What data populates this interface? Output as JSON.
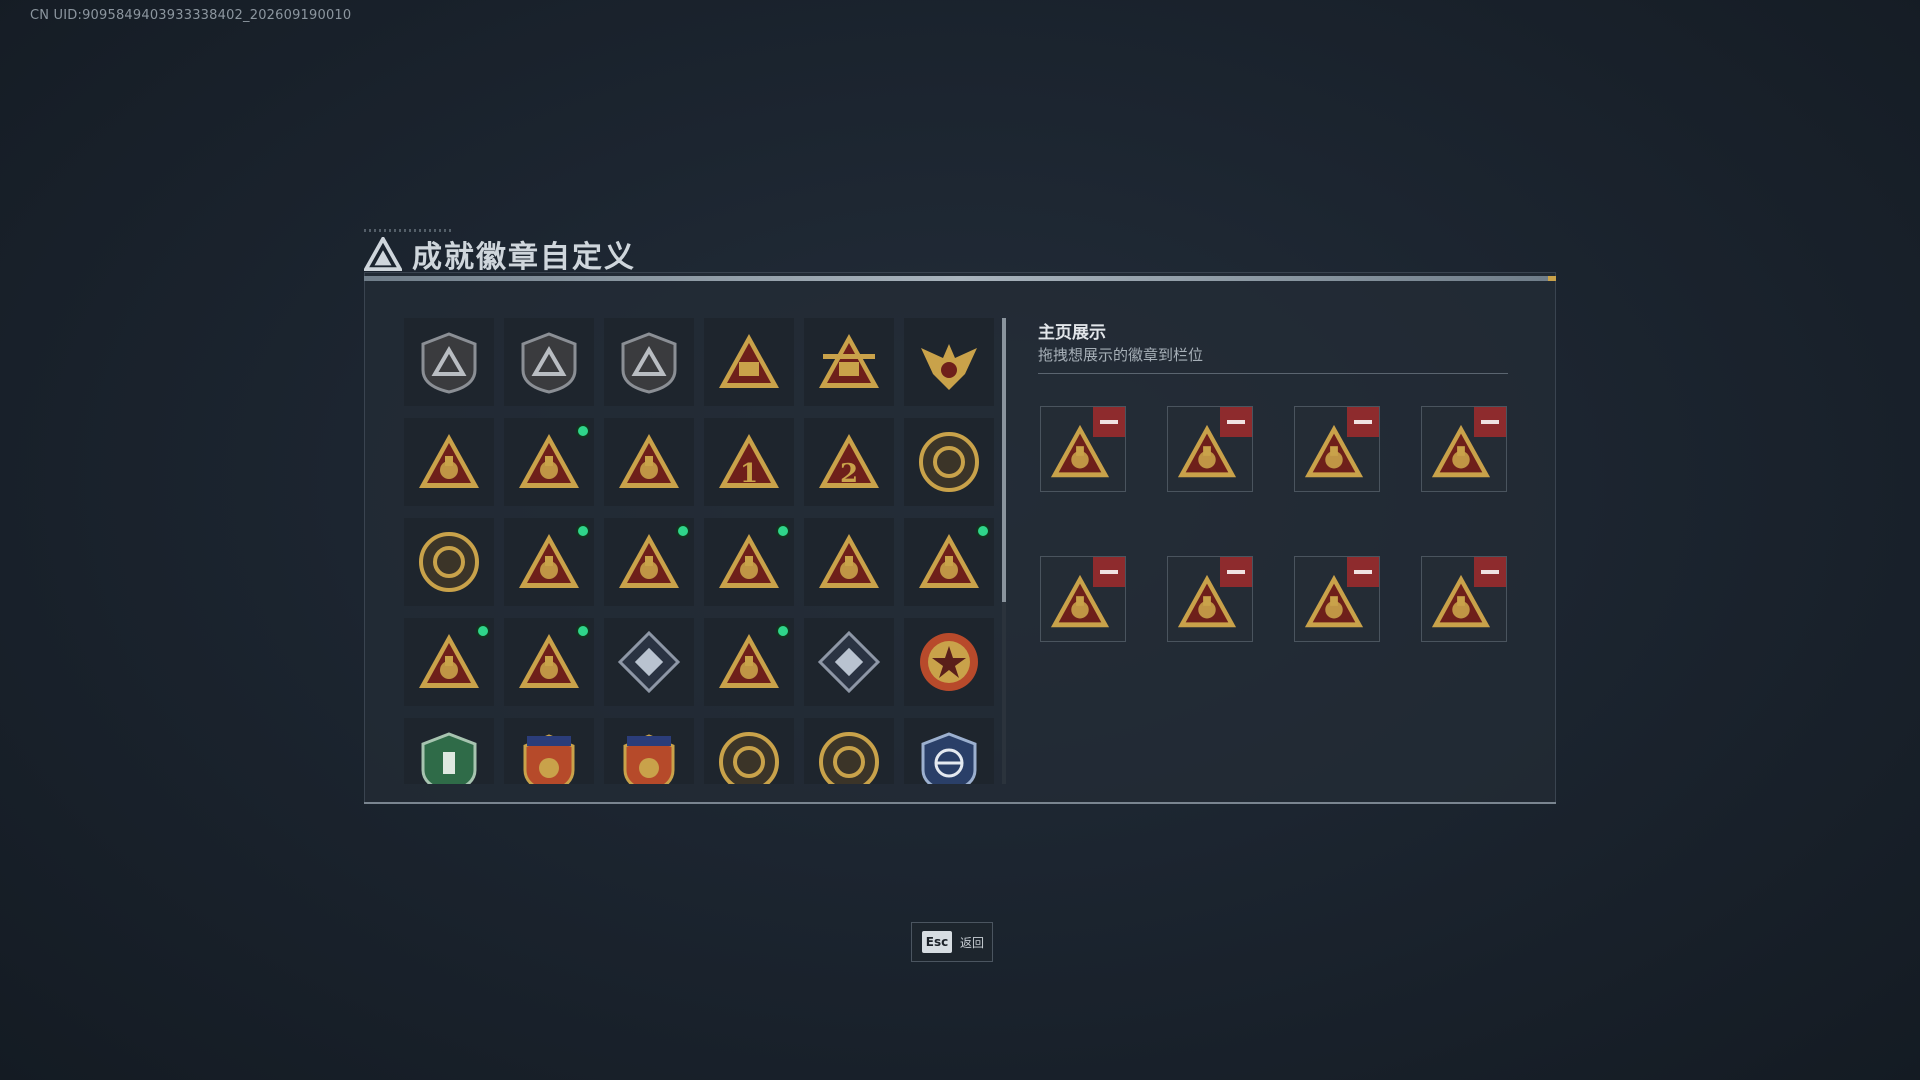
{
  "uid_text": "CN UID:9095849403933338402_202609190010",
  "title": "成就徽章自定义",
  "showcase": {
    "title": "主页展示",
    "subtitle": "拖拽想展示的徽章到栏位"
  },
  "badges": [
    {
      "icon": "shield-emblem-icon",
      "new": false
    },
    {
      "icon": "shield-helicopter-icon",
      "new": false
    },
    {
      "icon": "shield-diamond-icon",
      "new": false
    },
    {
      "icon": "triangle-sb-icon",
      "new": false
    },
    {
      "icon": "triangle-winged-sb-icon",
      "new": false
    },
    {
      "icon": "eagle-crest-icon",
      "new": false
    },
    {
      "icon": "triangle-hand-icon",
      "new": false
    },
    {
      "icon": "triangle-bowl-icon",
      "new": true
    },
    {
      "icon": "triangle-soldier-icon",
      "new": false
    },
    {
      "icon": "triangle-number-one-icon",
      "new": false
    },
    {
      "icon": "triangle-number-two-icon",
      "new": false
    },
    {
      "icon": "round-wreath-icon",
      "new": false
    },
    {
      "icon": "round-helmet-icon",
      "new": false
    },
    {
      "icon": "triangle-bottle-icon",
      "new": true
    },
    {
      "icon": "triangle-runner-icon",
      "new": true
    },
    {
      "icon": "triangle-dice-icon",
      "new": true
    },
    {
      "icon": "triangle-jumpers-icon",
      "new": false
    },
    {
      "icon": "triangle-explosion-icon",
      "new": true
    },
    {
      "icon": "triangle-rocket-icon",
      "new": true
    },
    {
      "icon": "triangle-fish-icon",
      "new": true
    },
    {
      "icon": "diamond-cube-icon",
      "new": false
    },
    {
      "icon": "triangle-diver-icon",
      "new": true
    },
    {
      "icon": "diamond-launcher-icon",
      "new": false
    },
    {
      "icon": "star-roundel-icon",
      "new": false
    },
    {
      "icon": "green-shield-icon",
      "new": false
    },
    {
      "icon": "blue-star-crest-icon",
      "new": false
    },
    {
      "icon": "blue-star-crest-2-icon",
      "new": false
    },
    {
      "icon": "round-swirl-icon",
      "new": false
    },
    {
      "icon": "round-eye-icon",
      "new": false
    },
    {
      "icon": "target-shield-icon",
      "new": false
    }
  ],
  "slots": [
    {
      "icon": "triangle-rocket-icon"
    },
    {
      "icon": "triangle-explosion-icon"
    },
    {
      "icon": "triangle-runner-icon"
    },
    {
      "icon": "triangle-bottle-icon"
    },
    {
      "icon": "triangle-fish-icon"
    },
    {
      "icon": "triangle-diver-icon"
    },
    {
      "icon": "triangle-dice-icon"
    },
    {
      "icon": "triangle-bowl-icon"
    }
  ],
  "esc": {
    "key": "Esc",
    "label": "返回"
  },
  "colors": {
    "gold": "#c9a24a",
    "dark_red": "#6e1f1a",
    "new_dot": "#2fd58a",
    "remove_red": "#8e2b2d"
  }
}
